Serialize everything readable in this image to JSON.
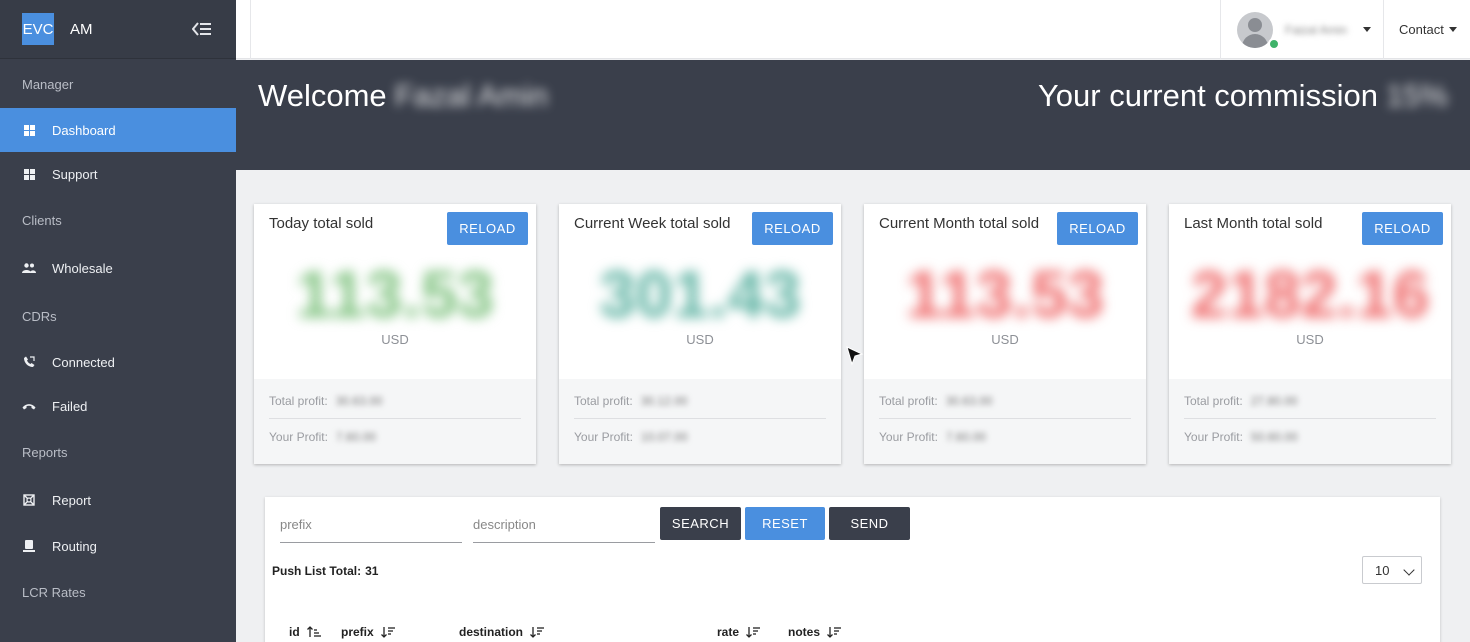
{
  "brand": {
    "logo": "EVC",
    "name": "AM"
  },
  "sidebar": {
    "sections": [
      {
        "label": "Manager",
        "items": [
          {
            "label": "Dashboard",
            "icon": "grid-icon",
            "active": true
          },
          {
            "label": "Support",
            "icon": "grid-icon"
          }
        ]
      },
      {
        "label": "Clients",
        "items": [
          {
            "label": "Wholesale",
            "icon": "people-icon"
          }
        ]
      },
      {
        "label": "CDRs",
        "items": [
          {
            "label": "Connected",
            "icon": "phone-connected-icon"
          },
          {
            "label": "Failed",
            "icon": "phone-hangup-icon"
          }
        ]
      },
      {
        "label": "Reports",
        "items": [
          {
            "label": "Report",
            "icon": "report-icon"
          },
          {
            "label": "Routing",
            "icon": "routing-icon"
          }
        ]
      },
      {
        "label": "LCR Rates",
        "items": []
      }
    ]
  },
  "topbar": {
    "user_name": "Faizal Amin",
    "contact_label": "Contact"
  },
  "banner": {
    "welcome_label": "Welcome",
    "welcome_name": "Fazal Amin",
    "commission_label": "Your current commission",
    "commission_value": "15%"
  },
  "cards": [
    {
      "title": "Today total sold",
      "reload": "RELOAD",
      "value": "113.53",
      "currency": "USD",
      "total_profit_label": "Total profit:",
      "total_profit": "30.63.00",
      "your_profit_label": "Your Profit:",
      "your_profit": "7.60.00",
      "color": "#7fc27f"
    },
    {
      "title": "Current Week total sold",
      "reload": "RELOAD",
      "value": "301.43",
      "currency": "USD",
      "total_profit_label": "Total profit:",
      "total_profit": "30.12.00",
      "your_profit_label": "Your Profit:",
      "your_profit": "10.07.00",
      "color": "#5fb3a3"
    },
    {
      "title": "Current Month total sold",
      "reload": "RELOAD",
      "value": "113.53",
      "currency": "USD",
      "total_profit_label": "Total profit:",
      "total_profit": "30.63.00",
      "your_profit_label": "Your Profit:",
      "your_profit": "7.60.00",
      "color": "#ef6b6b"
    },
    {
      "title": "Last Month total sold",
      "reload": "RELOAD",
      "value": "2182.16",
      "currency": "USD",
      "total_profit_label": "Total profit:",
      "total_profit": "27.80.00",
      "your_profit_label": "Your Profit:",
      "your_profit": "50.60.00",
      "color": "#ef6b6b"
    }
  ],
  "push_list": {
    "prefix_placeholder": "prefix",
    "description_placeholder": "description",
    "search_label": "SEARCH",
    "reset_label": "RESET",
    "send_label": "SEND",
    "total_label": "Push List Total:",
    "total_value": "31",
    "page_size": "10",
    "columns": [
      "id",
      "prefix",
      "destination",
      "rate",
      "notes"
    ]
  }
}
